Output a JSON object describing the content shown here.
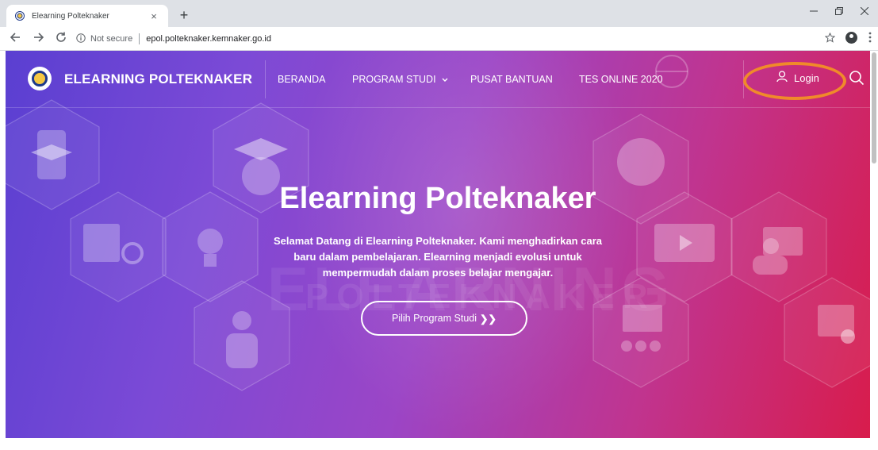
{
  "browser": {
    "tab_title": "Elearning Polteknaker",
    "tab_close": "×",
    "new_tab": "+",
    "security_label": "Not secure",
    "url": "epol.polteknaker.kemnaker.go.id",
    "colors": {
      "tabbar": "#dee1e6",
      "toolbar": "#ffffff"
    }
  },
  "site": {
    "brand": "ELEARNING POLTEKNAKER",
    "menu": {
      "beranda": "BERANDA",
      "program_studi": "PROGRAM STUDI",
      "pusat_bantuan": "PUSAT BANTUAN",
      "tes_online": "TES ONLINE 2020"
    },
    "login": "Login",
    "watermark_1": "ELEARNING",
    "watermark_2": "POLTEKNAKER",
    "colors": {
      "accent_highlight": "#f08a2a",
      "gradient_start": "#5a3fd1",
      "gradient_end": "#d81c4c"
    }
  },
  "hero": {
    "title": "Elearning Polteknaker",
    "subtitle": "Selamat Datang di Elearning Polteknaker. Kami menghadirkan cara baru dalam pembelajaran. Elearning menjadi evolusi untuk mempermudah dalam proses belajar mengajar.",
    "cta": "Pilih Program Studi",
    "cta_icon": "❯❯"
  },
  "icons": [
    "favicon-icon",
    "close-icon",
    "plus-icon",
    "back-arrow-icon",
    "forward-arrow-icon",
    "reload-icon",
    "info-icon",
    "star-icon",
    "profile-icon",
    "menu-kebab-icon",
    "minimize-icon",
    "restore-icon",
    "close-window-icon",
    "user-icon",
    "search-icon",
    "chevron-down-icon"
  ]
}
